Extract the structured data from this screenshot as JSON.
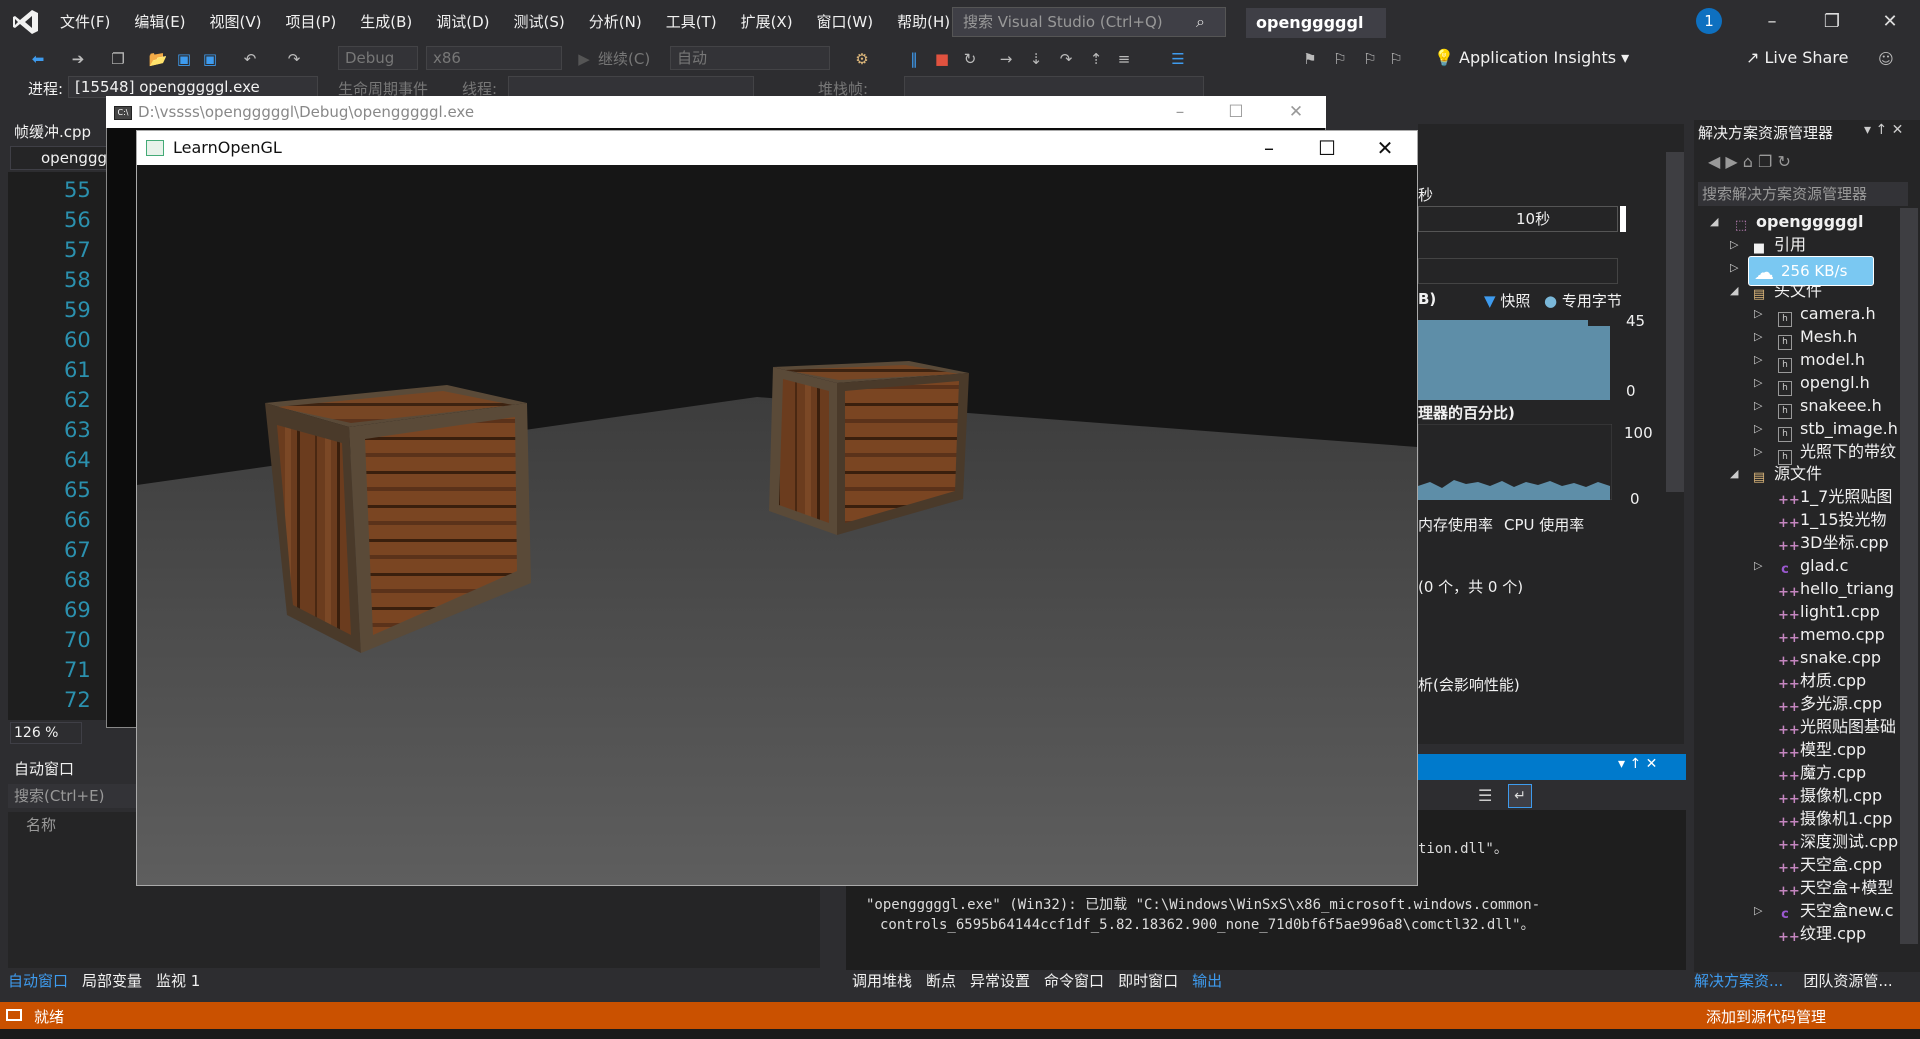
{
  "titlebar": {
    "menu": [
      "文件(F)",
      "编辑(E)",
      "视图(V)",
      "项目(P)",
      "生成(B)",
      "调试(D)",
      "测试(S)",
      "分析(N)",
      "工具(T)",
      "扩展(X)",
      "窗口(W)",
      "帮助(H)"
    ],
    "search_placeholder": "搜索 Visual Studio (Ctrl+Q)",
    "solution_name": "opengggggl",
    "notifications": "1"
  },
  "toolbar": {
    "config": "Debug",
    "platform": "x86",
    "continue_label": "继续(C)",
    "auto_label": "自动",
    "insights": "Application Insights",
    "liveshare": "Live Share"
  },
  "process": {
    "label": "进程:",
    "value": "[15548] opengggggl.exe",
    "lifecycle": "生命周期事件",
    "thread": "线程:",
    "stackframe": "堆栈帧:"
  },
  "editor": {
    "tab": "帧缓冲.cpp",
    "nav": "openggg",
    "lines": [
      "55",
      "56",
      "57",
      "58",
      "59",
      "60",
      "61",
      "62",
      "63",
      "64",
      "65",
      "66",
      "67",
      "68",
      "69",
      "70",
      "71",
      "72"
    ],
    "zoom": "126 %"
  },
  "autos": {
    "title": "自动窗口",
    "search": "搜索(Ctrl+E)",
    "col_name": "名称",
    "tabs": [
      "自动窗口",
      "局部变量",
      "监视 1"
    ]
  },
  "console": {
    "title": "D:\\vssss\\opengggggl\\Debug\\opengggggl.exe"
  },
  "glwindow": {
    "title": "LearnOpenGL"
  },
  "diagnostics": {
    "seconds": "秒",
    "ten_sec": "10秒",
    "mem_title": "B)",
    "snapshot": "快照",
    "private_bytes": "专用字节",
    "mem_max": "45",
    "mem_min": "0",
    "cpu_title": "理器的百分比)",
    "cpu_max": "100",
    "cpu_min": "0",
    "tab_mem": "内存使用率",
    "tab_cpu": "CPU 使用率",
    "events": "(0 个，共 0 个)",
    "analyze": "析(会影响性能)"
  },
  "output": {
    "lines": [
      "tion.dll\"。",
      "\"opengggggl.exe\" (Win32): 已加载 \"C:\\Windows\\WinSxS\\x86_microsoft.windows.common-",
      "controls_6595b64144ccf1df_5.82.18362.900_none_71d0bf6f5ae996a8\\comctl32.dll\"。"
    ],
    "tabs": [
      "调用堆栈",
      "断点",
      "异常设置",
      "命令窗口",
      "即时窗口",
      "输出"
    ]
  },
  "solution_explorer": {
    "title": "解决方案资源管理器",
    "search": "搜索解决方案资源管理器",
    "project": "opengggggl",
    "references": "引用",
    "headers_folder": "头文件",
    "headers": [
      "camera.h",
      "Mesh.h",
      "model.h",
      "opengl.h",
      "snakeee.h",
      "stb_image.h",
      "光照下的带纹"
    ],
    "sources_folder": "源文件",
    "sources": [
      "1_7光照贴图",
      "1_15投光物",
      "3D坐标.cpp",
      "glad.c",
      "hello_triang",
      "light1.cpp",
      "memo.cpp",
      "snake.cpp",
      "材质.cpp",
      "多光源.cpp",
      "光照贴图基础",
      "模型.cpp",
      "魔方.cpp",
      "摄像机.cpp",
      "摄像机1.cpp",
      "深度测试.cpp",
      "天空盒.cpp",
      "天空盒+模型",
      "天空盒new.c",
      "纹理.cpp"
    ],
    "net_speed": "256 KB/s",
    "tabs": [
      "解决方案资...",
      "团队资源管..."
    ]
  },
  "status": {
    "text": "就绪",
    "right": "添加到源代码管理"
  },
  "colors": {
    "accent": "#007acc",
    "status_bar": "#ca5100",
    "line_numbers": "#2b91af"
  }
}
